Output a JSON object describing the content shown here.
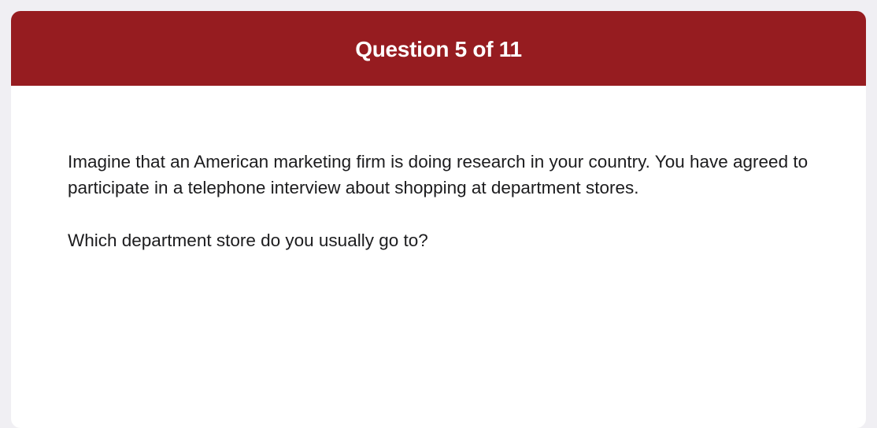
{
  "header": {
    "title": "Question 5 of 11"
  },
  "question": {
    "scenario": "Imagine that an American marketing firm is doing research in your country. You have agreed to participate in a telephone interview about shopping at department stores.",
    "prompt": "Which department store do you usually go to?"
  },
  "colors": {
    "header_background": "#961c20",
    "page_background": "#f0eff3",
    "card_background": "#ffffff",
    "text": "#1c1c1e"
  }
}
